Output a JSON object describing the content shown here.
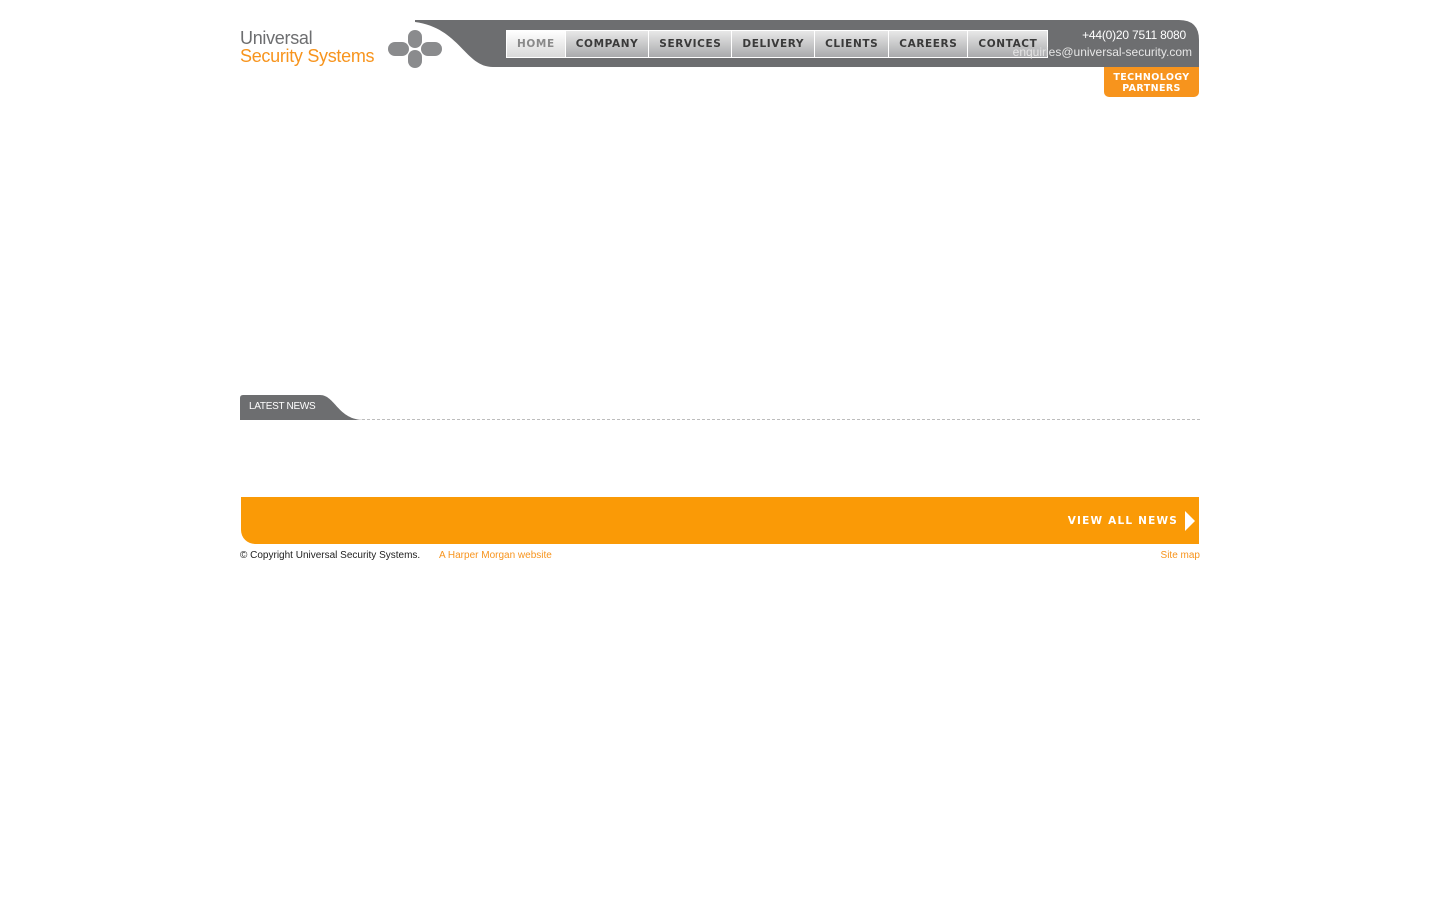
{
  "brand": {
    "name_line1": "Universal",
    "name_line2": "Security Systems"
  },
  "nav": {
    "items": [
      {
        "label": "HOME",
        "active": true
      },
      {
        "label": "COMPANY",
        "active": false
      },
      {
        "label": "SERVICES",
        "active": false
      },
      {
        "label": "DELIVERY",
        "active": false
      },
      {
        "label": "CLIENTS",
        "active": false
      },
      {
        "label": "CAREERS",
        "active": false
      },
      {
        "label": "CONTACT",
        "active": false
      }
    ]
  },
  "contact": {
    "phone": "+44(0)20 7511 8080",
    "email": "enquiries@universal-security.com"
  },
  "tech_partners": {
    "line1": "TECHNOLOGY",
    "line2": "PARTNERS"
  },
  "news": {
    "heading": "LATEST NEWS",
    "view_all_label": "VIEW ALL NEWS"
  },
  "footer": {
    "copyright": "© Copyright Universal Security Systems.",
    "credit_link": "A Harper Morgan website",
    "sitemap_link": "Site map"
  },
  "colors": {
    "accent_orange": "#f7941d",
    "bar_orange": "#fa9a06",
    "header_grey": "#6d6e70",
    "logo_grey": "#6d6e70"
  },
  "icons": {
    "logo_mark": "plus-cross-logo-icon",
    "view_all_arrow": "triangle-right-icon"
  }
}
